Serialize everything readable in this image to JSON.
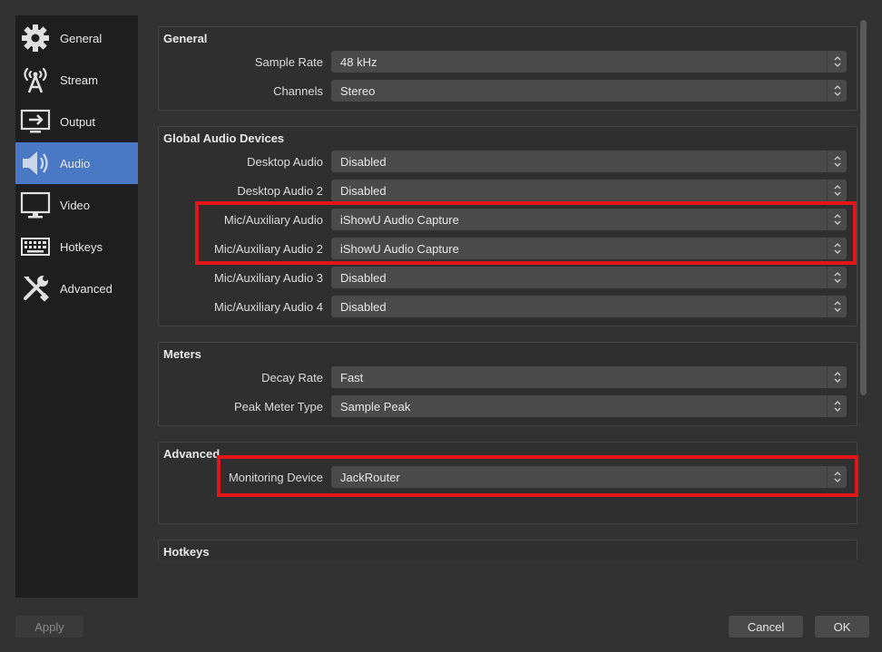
{
  "sidebar": {
    "items": [
      {
        "label": "General",
        "icon": "gear-icon"
      },
      {
        "label": "Stream",
        "icon": "antenna-icon"
      },
      {
        "label": "Output",
        "icon": "output-icon"
      },
      {
        "label": "Audio",
        "icon": "speaker-icon"
      },
      {
        "label": "Video",
        "icon": "monitor-icon"
      },
      {
        "label": "Hotkeys",
        "icon": "keyboard-icon"
      },
      {
        "label": "Advanced",
        "icon": "tools-icon"
      }
    ],
    "active": "Audio",
    "active_color": "#4a78c4"
  },
  "general": {
    "title": "General",
    "sample_rate": {
      "label": "Sample Rate",
      "value": "48 kHz"
    },
    "channels": {
      "label": "Channels",
      "value": "Stereo"
    }
  },
  "global_audio": {
    "title": "Global Audio Devices",
    "desktop_audio": {
      "label": "Desktop Audio",
      "value": "Disabled"
    },
    "desktop_audio_2": {
      "label": "Desktop Audio 2",
      "value": "Disabled"
    },
    "mic_aux": {
      "label": "Mic/Auxiliary Audio",
      "value": "iShowU Audio Capture"
    },
    "mic_aux_2": {
      "label": "Mic/Auxiliary Audio 2",
      "value": "iShowU Audio Capture"
    },
    "mic_aux_3": {
      "label": "Mic/Auxiliary Audio 3",
      "value": "Disabled"
    },
    "mic_aux_4": {
      "label": "Mic/Auxiliary Audio 4",
      "value": "Disabled"
    }
  },
  "meters": {
    "title": "Meters",
    "decay_rate": {
      "label": "Decay Rate",
      "value": "Fast"
    },
    "peak_meter_type": {
      "label": "Peak Meter Type",
      "value": "Sample Peak"
    }
  },
  "advanced": {
    "title": "Advanced",
    "monitoring_device": {
      "label": "Monitoring Device",
      "value": "JackRouter"
    }
  },
  "hotkeys": {
    "title": "Hotkeys"
  },
  "buttons": {
    "apply": "Apply",
    "cancel": "Cancel",
    "ok": "OK"
  },
  "highlight_color": "#e0161b"
}
